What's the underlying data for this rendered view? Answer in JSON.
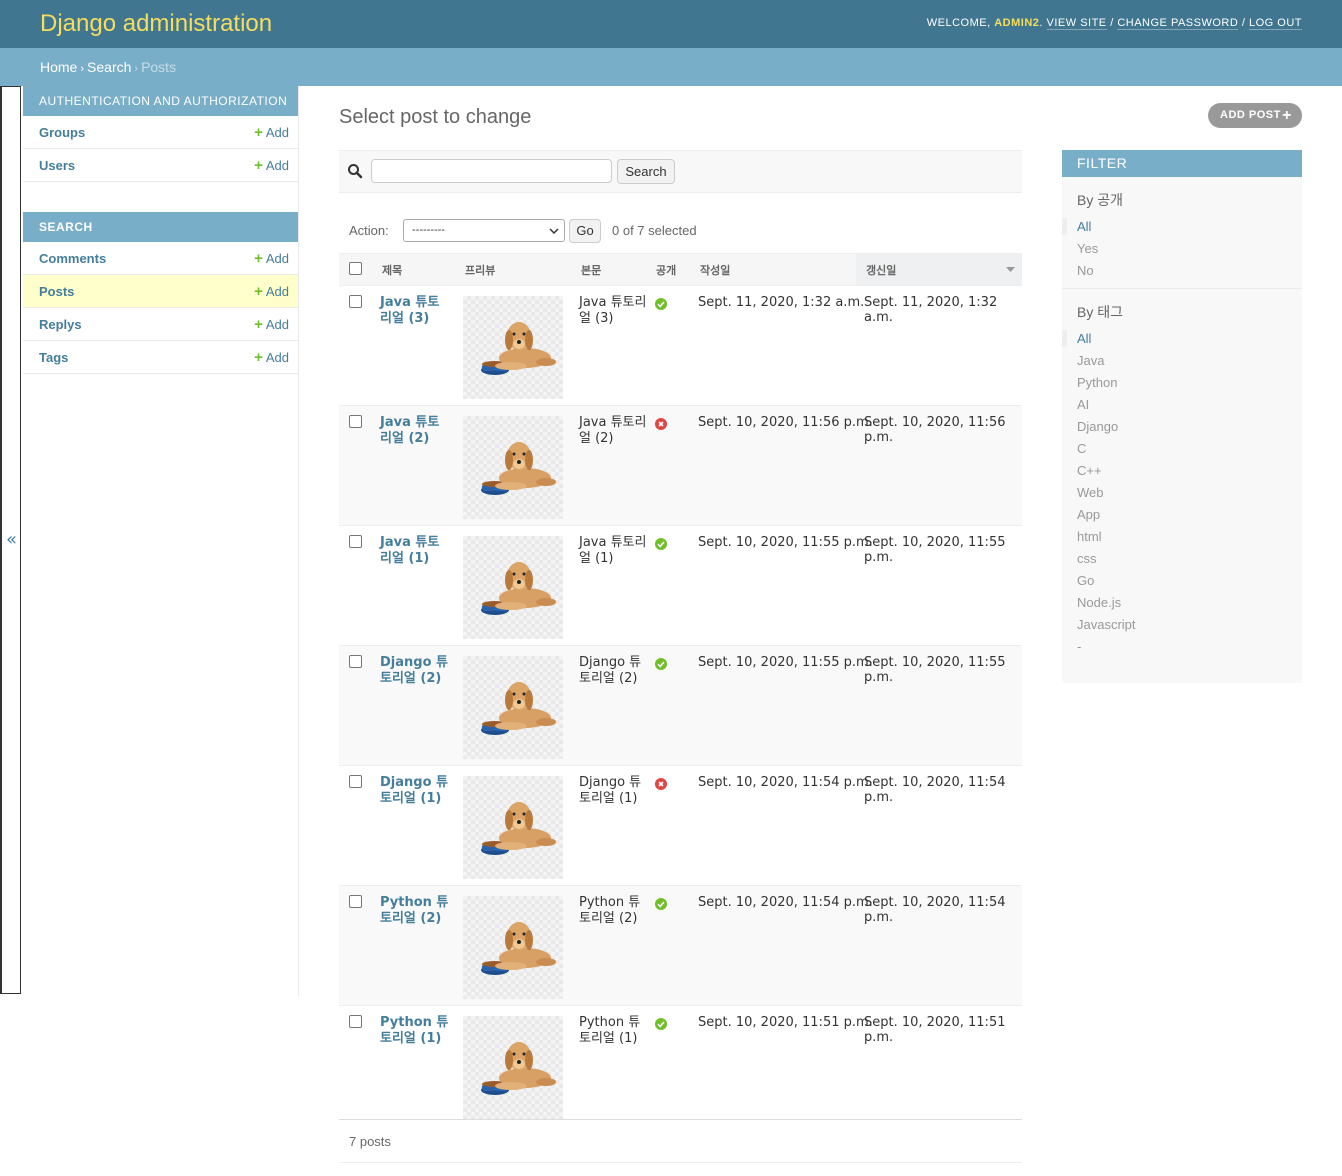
{
  "header": {
    "branding": "Django administration",
    "welcome": "Welcome,",
    "username": "admin2",
    "view_site": "View site",
    "change_password": "Change password",
    "log_out": "Log out"
  },
  "breadcrumbs": {
    "home": "Home",
    "app": "Search",
    "current": "Posts"
  },
  "sidebar": {
    "toggle": "«",
    "add_label": "Add",
    "modules": [
      {
        "caption": "Authentication and Authorization",
        "models": [
          {
            "name": "Groups"
          },
          {
            "name": "Users"
          }
        ]
      },
      {
        "caption": "Search",
        "models": [
          {
            "name": "Comments"
          },
          {
            "name": "Posts"
          },
          {
            "name": "Replys"
          },
          {
            "name": "Tags"
          }
        ]
      }
    ]
  },
  "content": {
    "title": "Select post to change",
    "add_button": "ADD POST",
    "search_button": "Search",
    "search_value": "",
    "action_label": "Action:",
    "action_selected": "---------",
    "go_button": "Go",
    "selected_count": "0 of 7 selected",
    "columns": [
      "제목",
      "프리뷰",
      "본문",
      "공개",
      "작성일",
      "갱신일"
    ],
    "rows": [
      {
        "title": "Java 튜토리얼 (3)",
        "body": "Java 튜토리얼 (3)",
        "public": true,
        "created": "Sept. 11, 2020, 1:32 a.m.",
        "updated": "Sept. 11, 2020, 1:32 a.m."
      },
      {
        "title": "Java 튜토리얼 (2)",
        "body": "Java 튜토리얼 (2)",
        "public": false,
        "created": "Sept. 10, 2020, 11:56 p.m.",
        "updated": "Sept. 10, 2020, 11:56 p.m."
      },
      {
        "title": "Java 튜토리얼 (1)",
        "body": "Java 튜토리얼 (1)",
        "public": true,
        "created": "Sept. 10, 2020, 11:55 p.m.",
        "updated": "Sept. 10, 2020, 11:55 p.m."
      },
      {
        "title": "Django 튜토리얼 (2)",
        "body": "Django 튜토리얼 (2)",
        "public": true,
        "created": "Sept. 10, 2020, 11:55 p.m.",
        "updated": "Sept. 10, 2020, 11:55 p.m."
      },
      {
        "title": "Django 튜토리얼 (1)",
        "body": "Django 튜토리얼 (1)",
        "public": false,
        "created": "Sept. 10, 2020, 11:54 p.m.",
        "updated": "Sept. 10, 2020, 11:54 p.m."
      },
      {
        "title": "Python 튜토리얼 (2)",
        "body": "Python 튜토리얼 (2)",
        "public": true,
        "created": "Sept. 10, 2020, 11:54 p.m.",
        "updated": "Sept. 10, 2020, 11:54 p.m."
      },
      {
        "title": "Python 튜토리얼 (1)",
        "body": "Python 튜토리얼 (1)",
        "public": true,
        "created": "Sept. 10, 2020, 11:51 p.m.",
        "updated": "Sept. 10, 2020, 11:51 p.m."
      }
    ],
    "result_count": "7 posts"
  },
  "filter": {
    "title": "FILTER",
    "groups": [
      {
        "heading": "By 공개",
        "options": [
          "All",
          "Yes",
          "No"
        ],
        "selected": 0
      },
      {
        "heading": "By 태그",
        "options": [
          "All",
          "Java",
          "Python",
          "AI",
          "Django",
          "C",
          "C++",
          "Web",
          "App",
          "html",
          "css",
          "Go",
          "Node.js",
          "Javascript",
          "-"
        ],
        "selected": 0
      }
    ]
  },
  "colors": {
    "header_bg": "#417690",
    "branding": "#f5dd5d",
    "breadcrumb_bg": "#79aec8",
    "link": "#447e9b",
    "add_plus": "#70bf2b",
    "current_row": "#ffffcc",
    "status_yes": "#70bf2b",
    "status_no": "#dd4646"
  },
  "icons": {
    "search": "search-icon",
    "status_yes": "check-circle-icon",
    "status_no": "x-circle-icon",
    "sort": "sort-descending-icon",
    "toggle": "collapse-sidebar-icon"
  }
}
